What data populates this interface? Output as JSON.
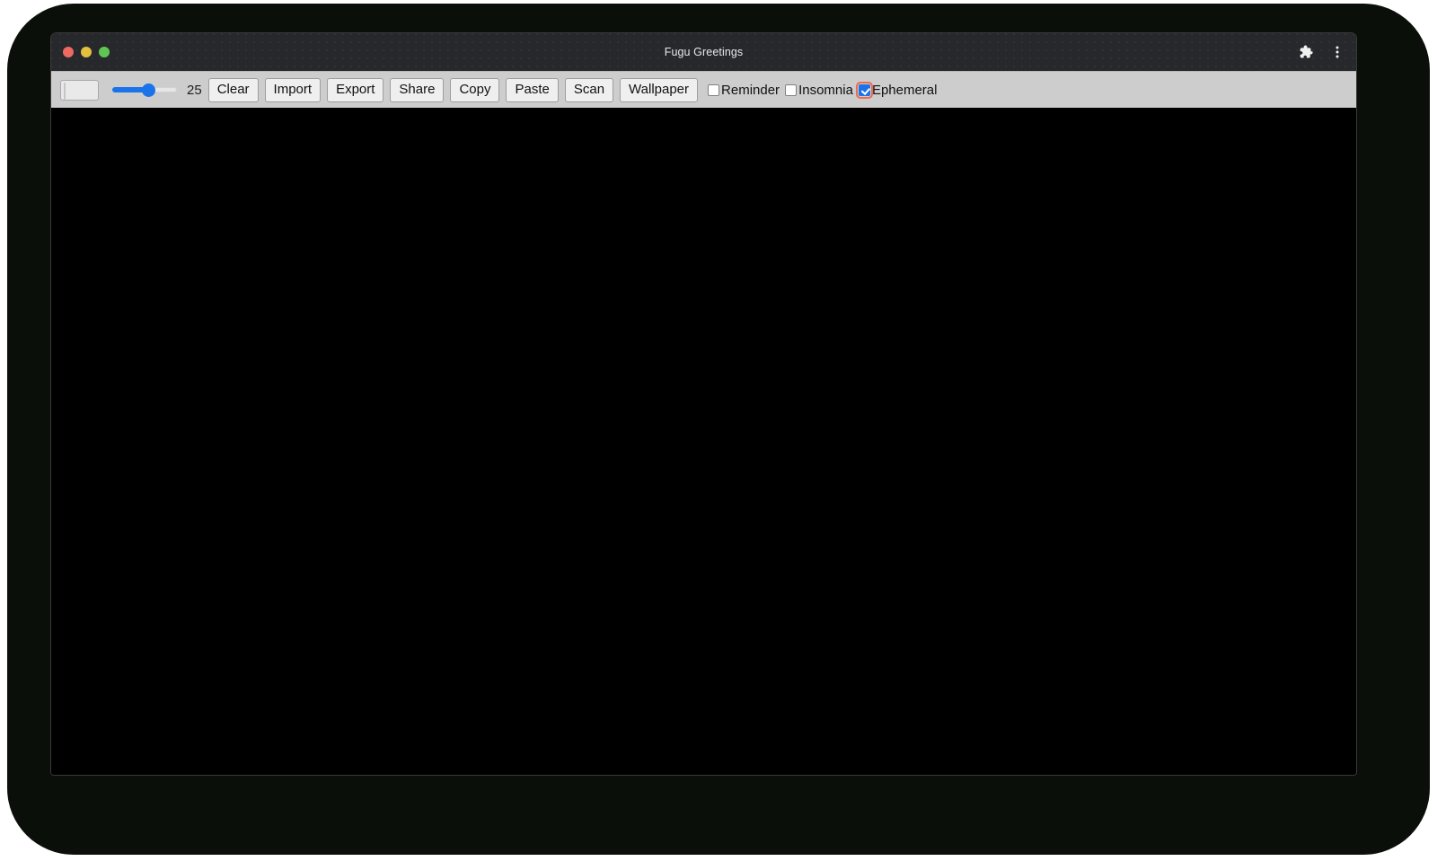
{
  "window": {
    "title": "Fugu Greetings",
    "traffic_lights": [
      {
        "name": "close",
        "color": "#ec6a5f"
      },
      {
        "name": "minimize",
        "color": "#e4bf40"
      },
      {
        "name": "maximize",
        "color": "#61c554"
      }
    ],
    "title_bar_actions": [
      {
        "name": "extensions-icon",
        "label": "Extensions"
      },
      {
        "name": "more-menu-icon",
        "label": "Customize and control"
      }
    ]
  },
  "toolbar": {
    "color_picker": {
      "label": "Color",
      "value": "#fbfbfb"
    },
    "slider": {
      "label": "Line width",
      "value": "25",
      "min": "1",
      "max": "50",
      "percent": 55,
      "accent": "#1a73e8"
    },
    "buttons": [
      {
        "name": "clear-button",
        "label": "Clear"
      },
      {
        "name": "import-button",
        "label": "Import"
      },
      {
        "name": "export-button",
        "label": "Export"
      },
      {
        "name": "share-button",
        "label": "Share"
      },
      {
        "name": "copy-button",
        "label": "Copy"
      },
      {
        "name": "paste-button",
        "label": "Paste"
      },
      {
        "name": "scan-button",
        "label": "Scan"
      },
      {
        "name": "wallpaper-button",
        "label": "Wallpaper"
      }
    ],
    "checkboxes": [
      {
        "name": "reminder-checkbox",
        "label": "Reminder",
        "checked": false,
        "focused": false
      },
      {
        "name": "insomnia-checkbox",
        "label": "Insomnia",
        "checked": false,
        "focused": false
      },
      {
        "name": "ephemeral-checkbox",
        "label": "Ephemeral",
        "checked": true,
        "focused": true
      }
    ]
  },
  "canvas": {
    "name": "drawing-canvas",
    "background": "#000000",
    "content": ""
  },
  "colors": {
    "titlebar_bg": "#26282c",
    "toolbar_bg": "#cdcdcd",
    "accent": "#1a73e8",
    "focus_ring": "#f06a4d",
    "bezel": "#0b0f09"
  }
}
